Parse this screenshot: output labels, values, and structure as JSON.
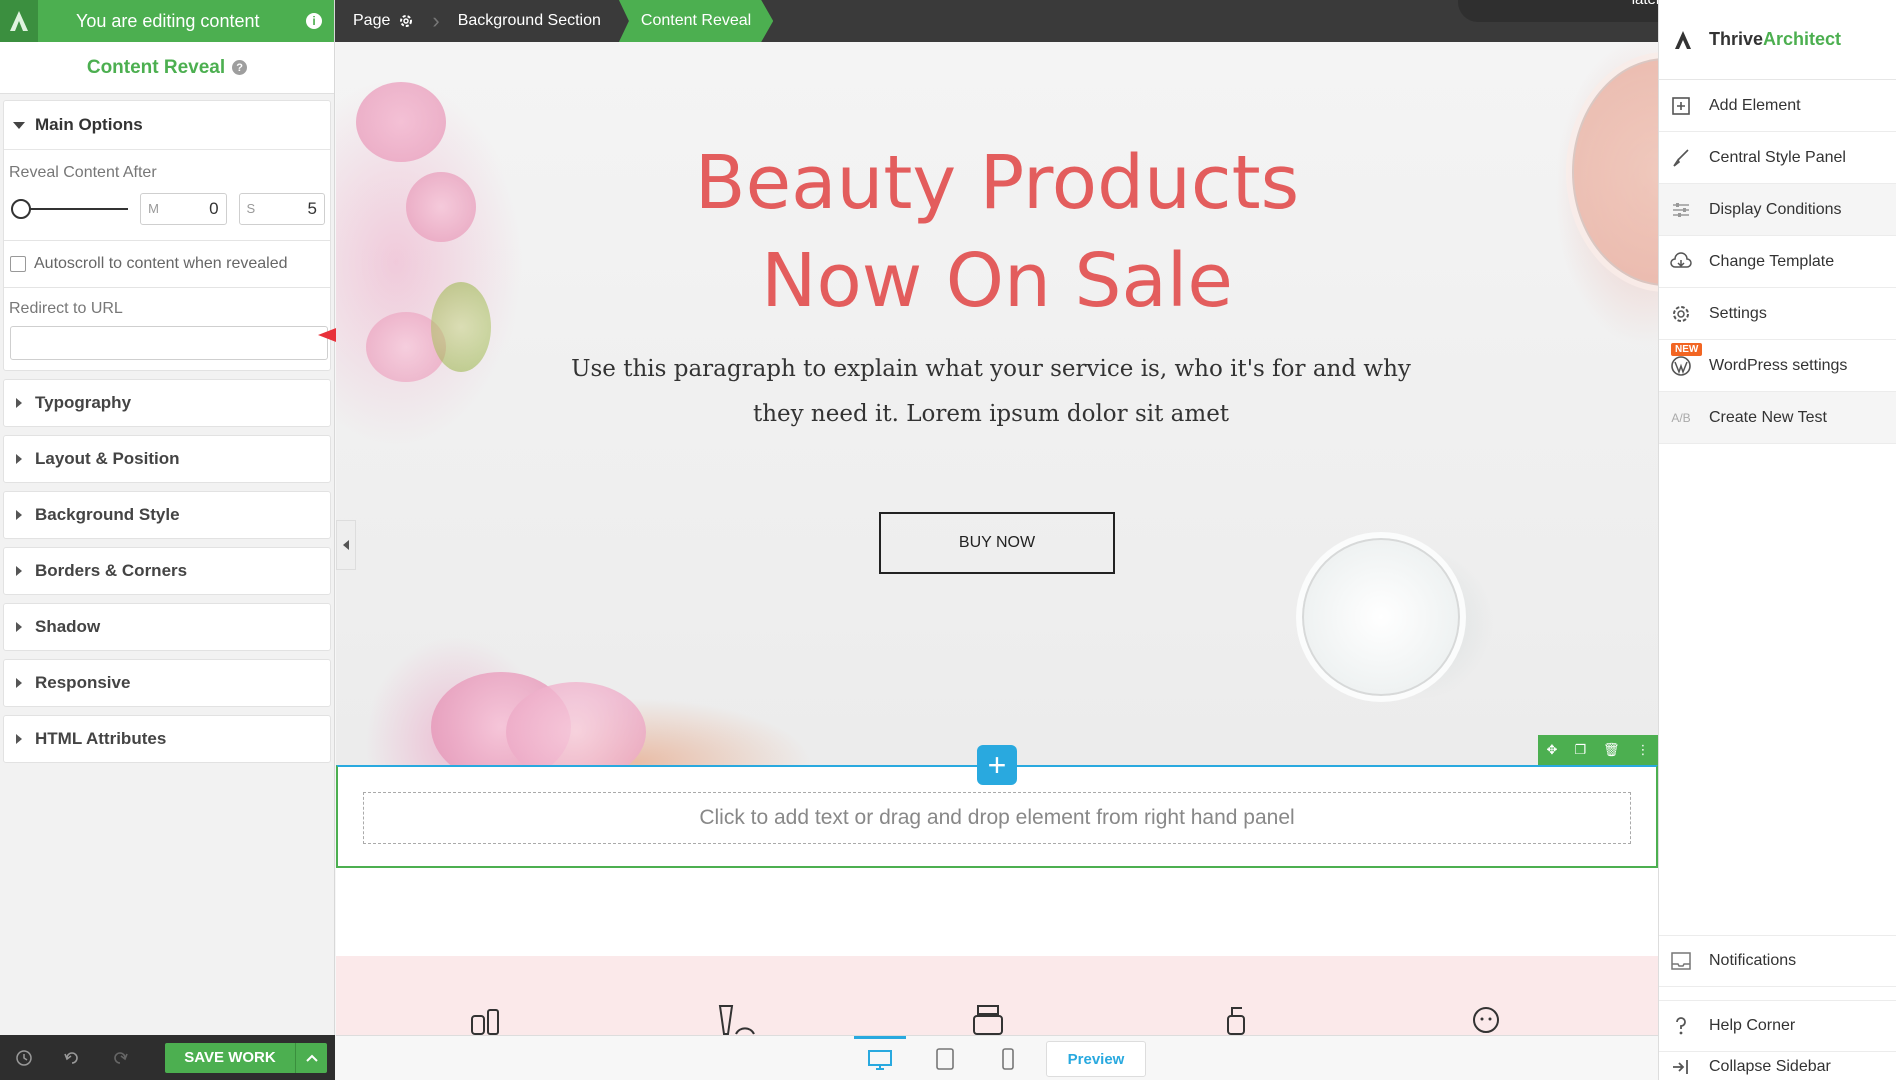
{
  "editor": {
    "editing_text": "You are editing content",
    "panel_title": "Content Reveal",
    "main_options": {
      "title": "Main Options",
      "reveal_label": "Reveal Content After",
      "minutes_unit": "M",
      "minutes_value": "0",
      "seconds_unit": "S",
      "seconds_value": "5",
      "autoscroll_label": "Autoscroll to content when revealed",
      "redirect_label": "Redirect to URL",
      "redirect_value": ""
    },
    "sections": [
      "Typography",
      "Layout & Position",
      "Background Style",
      "Borders & Corners",
      "Shadow",
      "Responsive",
      "HTML Attributes"
    ],
    "save_label": "SAVE WORK"
  },
  "breadcrumb": {
    "page": "Page",
    "background_section": "Background Section",
    "content_reveal": "Content Reveal"
  },
  "toast": {
    "text": "later tonight."
  },
  "canvas": {
    "title_line1": "Beauty Products",
    "title_line2": "Now On Sale",
    "paragraph": "Use this paragraph to explain what your service is, who it's for and why they need it. Lorem ipsum dolor sit amet",
    "button_label": "BUY NOW",
    "drop_hint": "Click to add text or drag and drop element from right hand panel",
    "title_color": "#e35d5d"
  },
  "device_bar": {
    "preview_label": "Preview"
  },
  "sidebar": {
    "brand_part1": "Thrive",
    "brand_part2": "Architect",
    "items": [
      {
        "label": "Add Element",
        "icon": "plus-square-icon"
      },
      {
        "label": "Central Style Panel",
        "icon": "brush-icon"
      },
      {
        "label": "Display Conditions",
        "icon": "sliders-icon"
      },
      {
        "label": "Change Template",
        "icon": "cloud-download-icon"
      },
      {
        "label": "Settings",
        "icon": "gear-icon"
      },
      {
        "label": "WordPress settings",
        "icon": "wordpress-icon",
        "badge": "NEW"
      },
      {
        "label": "Create New Test",
        "icon": "ab-test-icon"
      }
    ],
    "bottom_items": [
      {
        "label": "Notifications",
        "icon": "inbox-icon"
      },
      {
        "label": "Help Corner",
        "icon": "question-icon"
      },
      {
        "label": "Collapse Sidebar",
        "icon": "collapse-icon"
      }
    ]
  },
  "colors": {
    "brand_green": "#4caf50",
    "accent_blue": "#29a9df",
    "dark_bar": "#3a3a3a"
  }
}
